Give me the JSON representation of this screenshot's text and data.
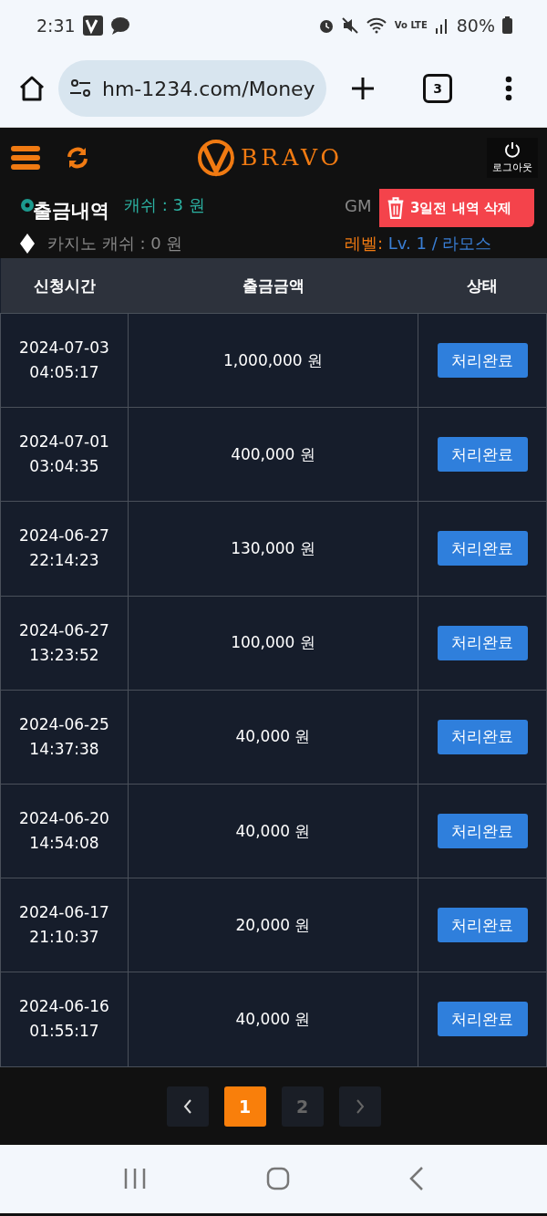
{
  "status_bar": {
    "time": "2:31",
    "battery": "80%",
    "network": "Vo LTE"
  },
  "browser": {
    "url": "hm-1234.com/Money",
    "tab_count": "3"
  },
  "header": {
    "brand": "BRAVO",
    "logout": "로그아웃"
  },
  "page": {
    "title": "출금내역",
    "delete_button": "3일전 내역 삭제"
  },
  "account": {
    "sports_cash": "캐쉬 :  3 원",
    "casino_cash": "카지노 캐쉬 :  0 원",
    "timezone": "GM",
    "level_label": "레벨:",
    "level_value": "Lv. 1 / 라모스"
  },
  "table": {
    "columns": [
      "신청시간",
      "출금금액",
      "상태"
    ],
    "rows": [
      {
        "date": "2024-07-03",
        "time": "04:05:17",
        "amount": "1,000,000 원",
        "status": "처리완료"
      },
      {
        "date": "2024-07-01",
        "time": "03:04:35",
        "amount": "400,000 원",
        "status": "처리완료"
      },
      {
        "date": "2024-06-27",
        "time": "22:14:23",
        "amount": "130,000 원",
        "status": "처리완료"
      },
      {
        "date": "2024-06-27",
        "time": "13:23:52",
        "amount": "100,000 원",
        "status": "처리완료"
      },
      {
        "date": "2024-06-25",
        "time": "14:37:38",
        "amount": "40,000 원",
        "status": "처리완료"
      },
      {
        "date": "2024-06-20",
        "time": "14:54:08",
        "amount": "40,000 원",
        "status": "처리완료"
      },
      {
        "date": "2024-06-17",
        "time": "21:10:37",
        "amount": "20,000 원",
        "status": "처리완료"
      },
      {
        "date": "2024-06-16",
        "time": "01:55:17",
        "amount": "40,000 원",
        "status": "처리완료"
      }
    ]
  },
  "pagination": {
    "pages": [
      {
        "label": "1",
        "selected": true
      },
      {
        "label": "2",
        "selected": false
      }
    ]
  }
}
